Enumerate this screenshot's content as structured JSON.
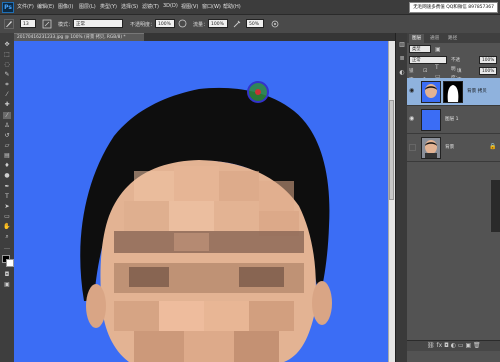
{
  "menubar": {
    "logo": "Ps",
    "items": [
      "文件(F)",
      "编辑(E)",
      "图像(I)",
      "图层(L)",
      "类型(Y)",
      "选择(S)",
      "滤镜(T)",
      "3D(D)",
      "视图(V)",
      "窗口(W)",
      "帮助(H)"
    ],
    "notice": "无毛网速多费值 QQ和微信 897857367"
  },
  "options": {
    "size": "13",
    "mode_label": "模式：",
    "mode_value": "正常",
    "opacity_label": "不透明度：",
    "opacity_value": "100%",
    "flow_label": "流量：",
    "flow_value": "100%",
    "extra_value": "50%"
  },
  "document": {
    "tab": "20170416231233.jpg @ 100% (背景 拷贝, RGB/8) *"
  },
  "layers_panel": {
    "tabs": [
      "图层",
      "通道",
      "路径"
    ],
    "kind_label": "类型",
    "blend_mode": "正常",
    "opacity_label": "不透明度：",
    "opacity_value": "100%",
    "lock_label": "锁定：",
    "fill_label": "填充：",
    "fill_value": "100%",
    "layers": [
      {
        "name": "背景 拷贝",
        "selected": true,
        "visible": true,
        "has_mask": true
      },
      {
        "name": "图层 1",
        "selected": false,
        "visible": true,
        "has_mask": false
      },
      {
        "name": "背景",
        "selected": false,
        "visible": false,
        "has_mask": false
      }
    ]
  },
  "colors": {
    "canvas_blue": "#3b6df5",
    "panel": "#535353",
    "selected_layer": "#8fb2dd",
    "hair": "#0e0e0e",
    "skin": "#e3b393"
  }
}
